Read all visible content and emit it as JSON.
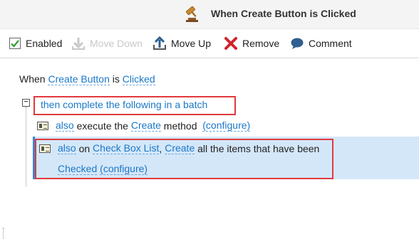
{
  "header": {
    "title": "When Create Button is Clicked",
    "icon": "gavel-icon"
  },
  "toolbar": {
    "enabled_label": "Enabled",
    "move_down_label": "Move Down",
    "move_up_label": "Move Up",
    "remove_label": "Remove",
    "comment_label": "Comment"
  },
  "rule": {
    "when_word": "When",
    "control": "Create Button",
    "is_word": "is",
    "event": "Clicked",
    "batch_label": "then complete the following in a batch",
    "action1": {
      "also": "also",
      "text1": "execute the",
      "method_name": "Create",
      "text2": "method",
      "configure": "(configure)"
    },
    "action2": {
      "also": "also",
      "text1": "on",
      "target": "Check Box List",
      "action_name": "Create",
      "text2": "all the items that have been",
      "state": "Checked",
      "configure": "(configure)"
    }
  },
  "colors": {
    "link": "#1b78c8",
    "highlight": "#e0393e",
    "selection": "#d4e7f9",
    "remove_x": "#d2232a"
  }
}
